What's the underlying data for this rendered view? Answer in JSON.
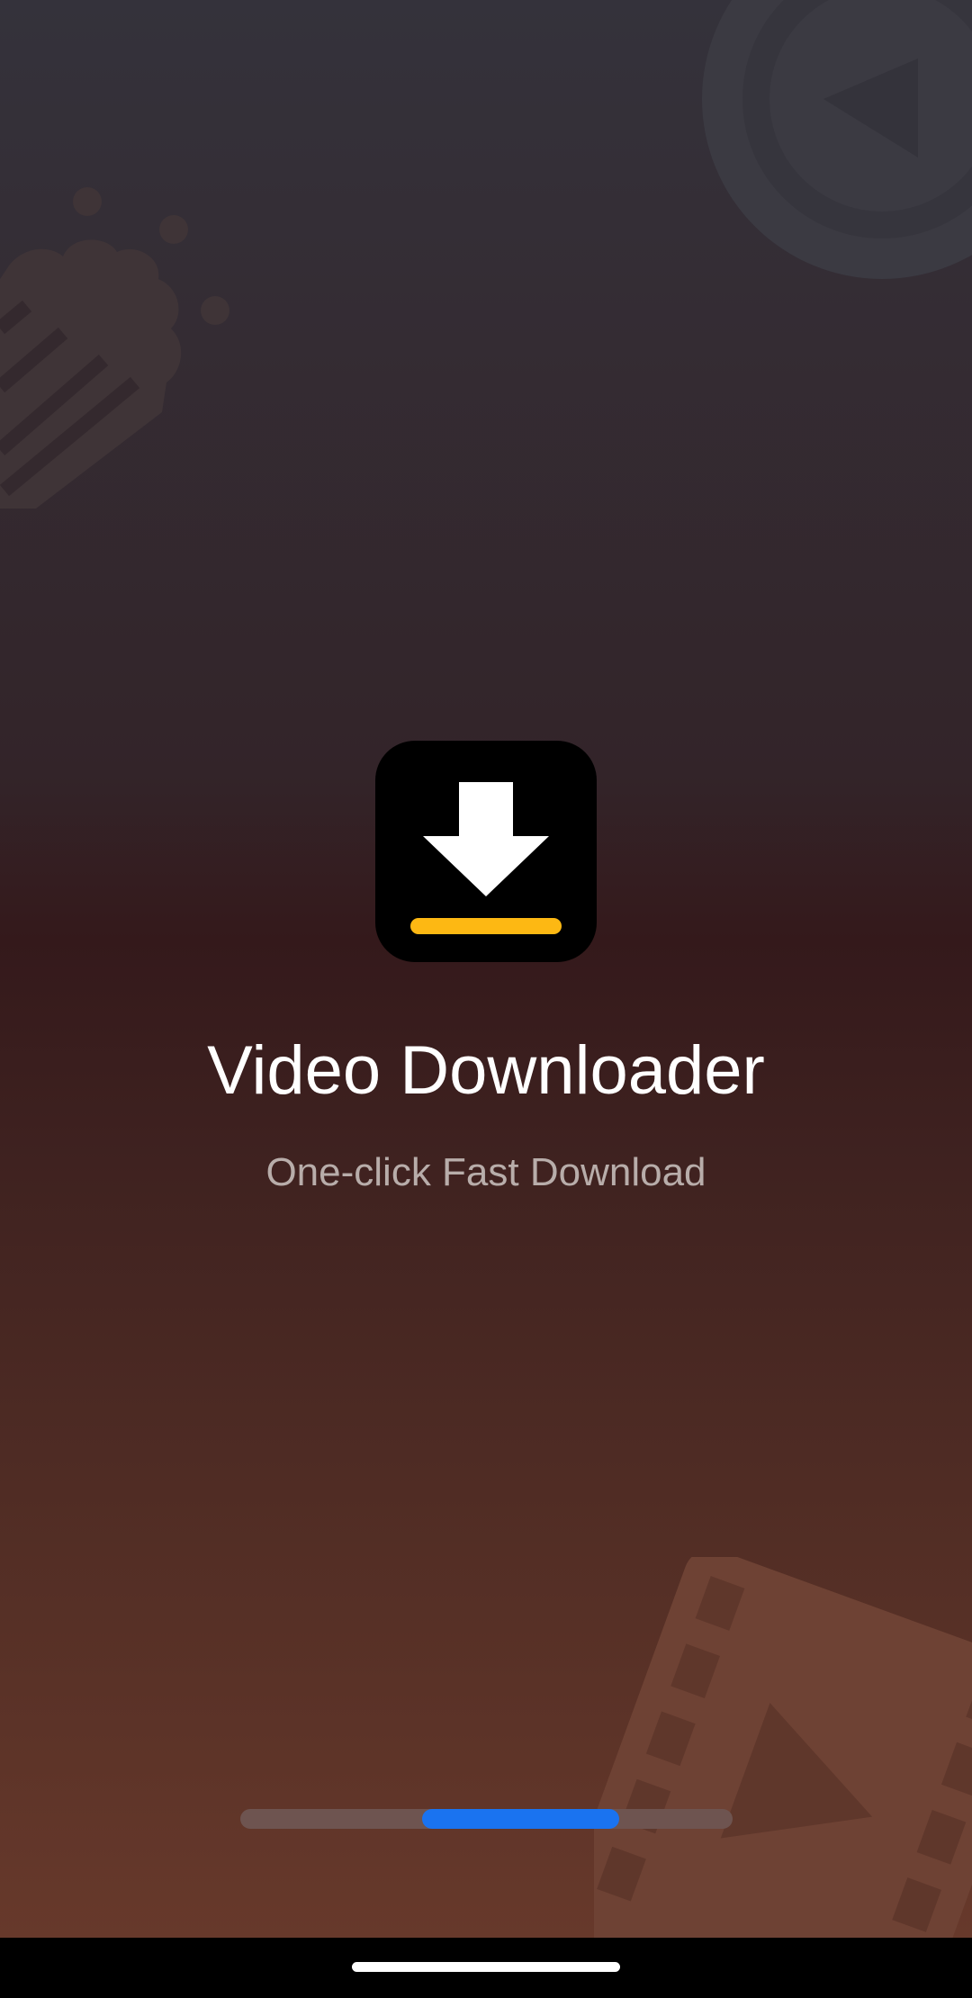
{
  "app": {
    "title": "Video Downloader",
    "tagline": "One-click Fast Download"
  },
  "icons": {
    "app_icon": "download-arrow-icon",
    "background_decor": [
      "popcorn-icon",
      "play-circle-icon",
      "film-strip-icon"
    ]
  },
  "loading": {
    "indicator_start": 0.37,
    "indicator_end": 0.77
  },
  "colors": {
    "accent_blue": "#1a73f0",
    "icon_underline": "#fdb813",
    "icon_background": "#000000",
    "title_text": "#ffffff",
    "tagline_text": "#b8adaa"
  }
}
